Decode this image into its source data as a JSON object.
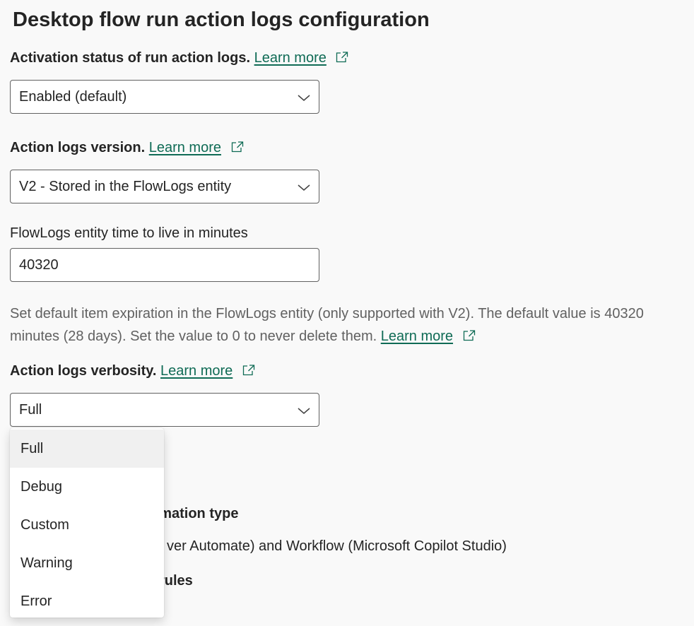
{
  "page_title": "Desktop flow run action logs configuration",
  "activation": {
    "label": "Activation status of run action logs.",
    "learn_more": "Learn more",
    "value": "Enabled (default)"
  },
  "version": {
    "label": "Action logs version.",
    "learn_more": "Learn more",
    "value": "V2 - Stored in the FlowLogs entity"
  },
  "ttl": {
    "label": "FlowLogs entity time to live in minutes",
    "value": "40320",
    "help_text": "Set default item expiration in the FlowLogs entity (only supported with V2). The default value is 40320 minutes (28 days). Set the value to 0 to never delete them.",
    "learn_more": "Learn more"
  },
  "verbosity": {
    "label": "Action logs verbosity.",
    "learn_more": "Learn more",
    "value": "Full",
    "options": [
      "Full",
      "Debug",
      "Custom",
      "Warning",
      "Error"
    ],
    "selected_index": 0
  },
  "obscured": {
    "automation_type_label": "omation type",
    "automation_type_value": "ver Automate) and Workflow (Microsoft Copilot Studio)",
    "rules_label": "rules"
  },
  "icons": {
    "external_link": "external-link-icon",
    "dropdown": "chevron-down-icon"
  },
  "colors": {
    "link": "#0f6b55",
    "background": "#f9f9f9",
    "border": "#616161",
    "selected_option": "#f0f0f0"
  }
}
